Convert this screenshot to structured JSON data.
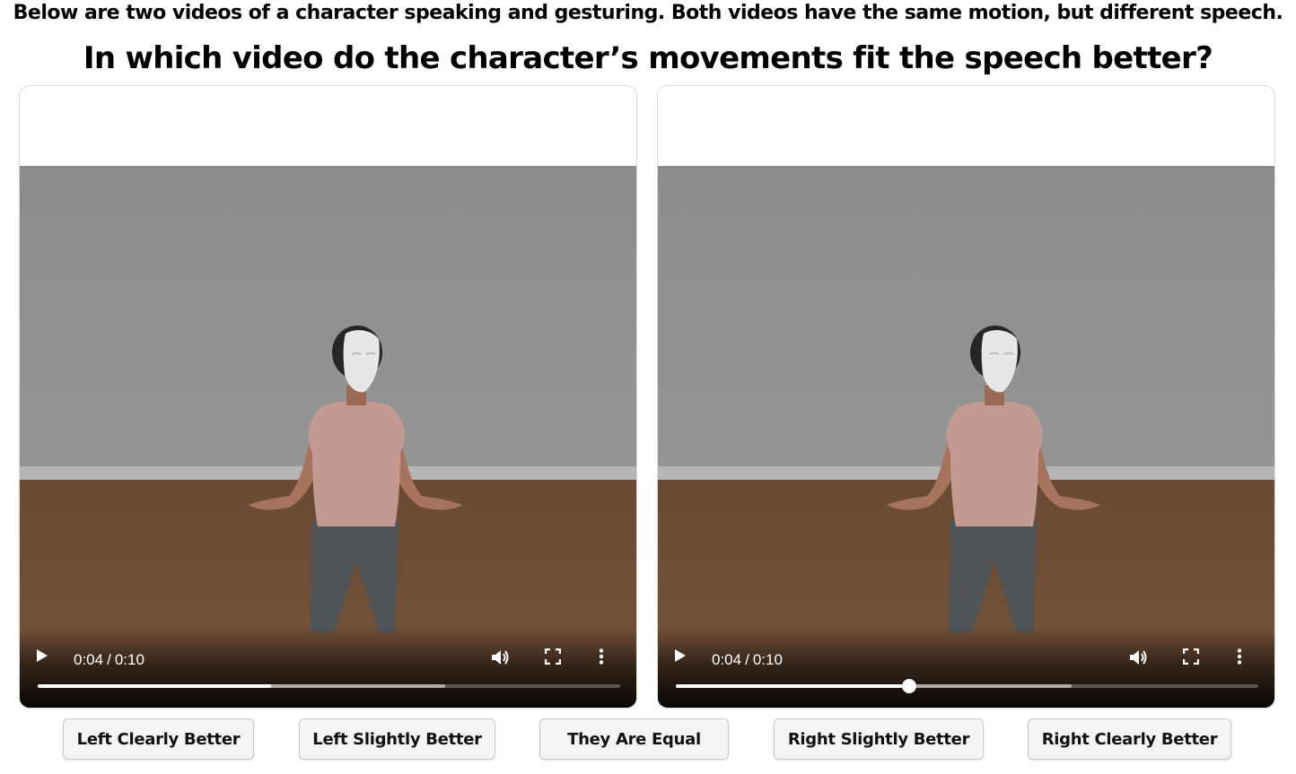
{
  "instructions": {
    "subtitle": "Below are two videos of a character speaking and gesturing. Both videos have the same motion, but different speech.",
    "question": "In which video do the character’s movements fit the speech better?"
  },
  "videos": [
    {
      "current_time": "0:04",
      "separator": "/",
      "duration": "0:10",
      "progress_percent": 40,
      "buffered_percent": 70,
      "scrubber_thumb_visible": false
    },
    {
      "current_time": "0:04",
      "separator": "/",
      "duration": "0:10",
      "progress_percent": 40,
      "buffered_percent": 68,
      "scrubber_thumb_visible": true
    }
  ],
  "video_controls": {
    "play_icon": "play-icon",
    "volume_icon": "volume-icon",
    "fullscreen_icon": "fullscreen-icon",
    "more_icon": "more-options-icon"
  },
  "ratings": [
    "Left Clearly Better",
    "Left Slightly Better",
    "They Are Equal",
    "Right Slightly Better",
    "Right Clearly Better"
  ],
  "colors": {
    "wall": "#8d8d8d",
    "floor": "#6e4d35",
    "shirt": "#c29a92",
    "jeans": "#4f5458",
    "mask": "#e6e6e6",
    "button_bg": "#f4f4f4"
  }
}
